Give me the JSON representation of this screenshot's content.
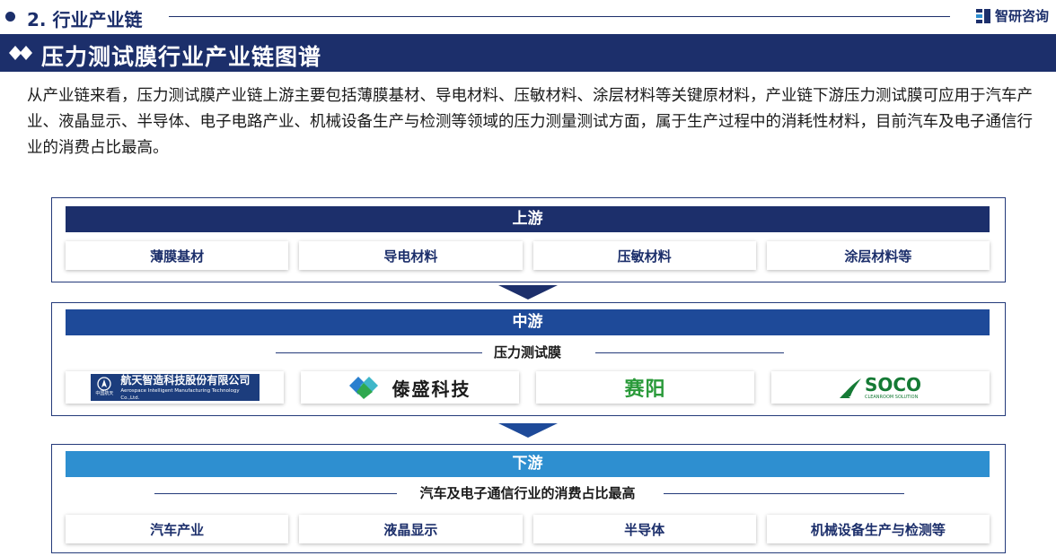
{
  "section": {
    "title": "2. 行业产业链"
  },
  "brand": {
    "name": "智研咨询"
  },
  "banner": {
    "title": "压力测试膜行业产业链图谱"
  },
  "intro": "从产业链来看，压力测试膜产业链上游主要包括薄膜基材、导电材料、压敏材料、涂层材料等关键原材料，产业链下游压力测试膜可应用于汽车产业、液晶显示、半导体、电子电路产业、机械设备生产与检测等领域的压力测量测试方面，属于生产过程中的消耗性材料，目前汽车及电子通信行业的消费占比最高。",
  "upstream": {
    "label": "上游",
    "items": [
      "薄膜基材",
      "导电材料",
      "压敏材料",
      "涂层材料等"
    ]
  },
  "midstream": {
    "label": "中游",
    "subtitle": "压力测试膜",
    "logos": [
      {
        "name": "aerospace-logo",
        "cn": "航天智造科技股份有限公司",
        "en": "Aerospace Intelligent Manufacturing Technology Co.,Ltd.",
        "small": "中国航天"
      },
      {
        "name": "shengsheng-logo",
        "cn": "傣盛科技"
      },
      {
        "name": "saiyang-logo",
        "cn": "赛阳"
      },
      {
        "name": "soco-logo",
        "cn": "SOCO",
        "en": "CLEANROOM SOLUTION"
      }
    ]
  },
  "downstream": {
    "label": "下游",
    "subtitle": "汽车及电子通信行业的消费占比最高",
    "items": [
      "汽车产业",
      "液晶显示",
      "半导体",
      "机械设备生产与检测等"
    ]
  },
  "colors": {
    "navy": "#1c2f6b",
    "mid_blue": "#1e4a99",
    "light_blue": "#2e8fd0",
    "green": "#2a9a3a"
  }
}
